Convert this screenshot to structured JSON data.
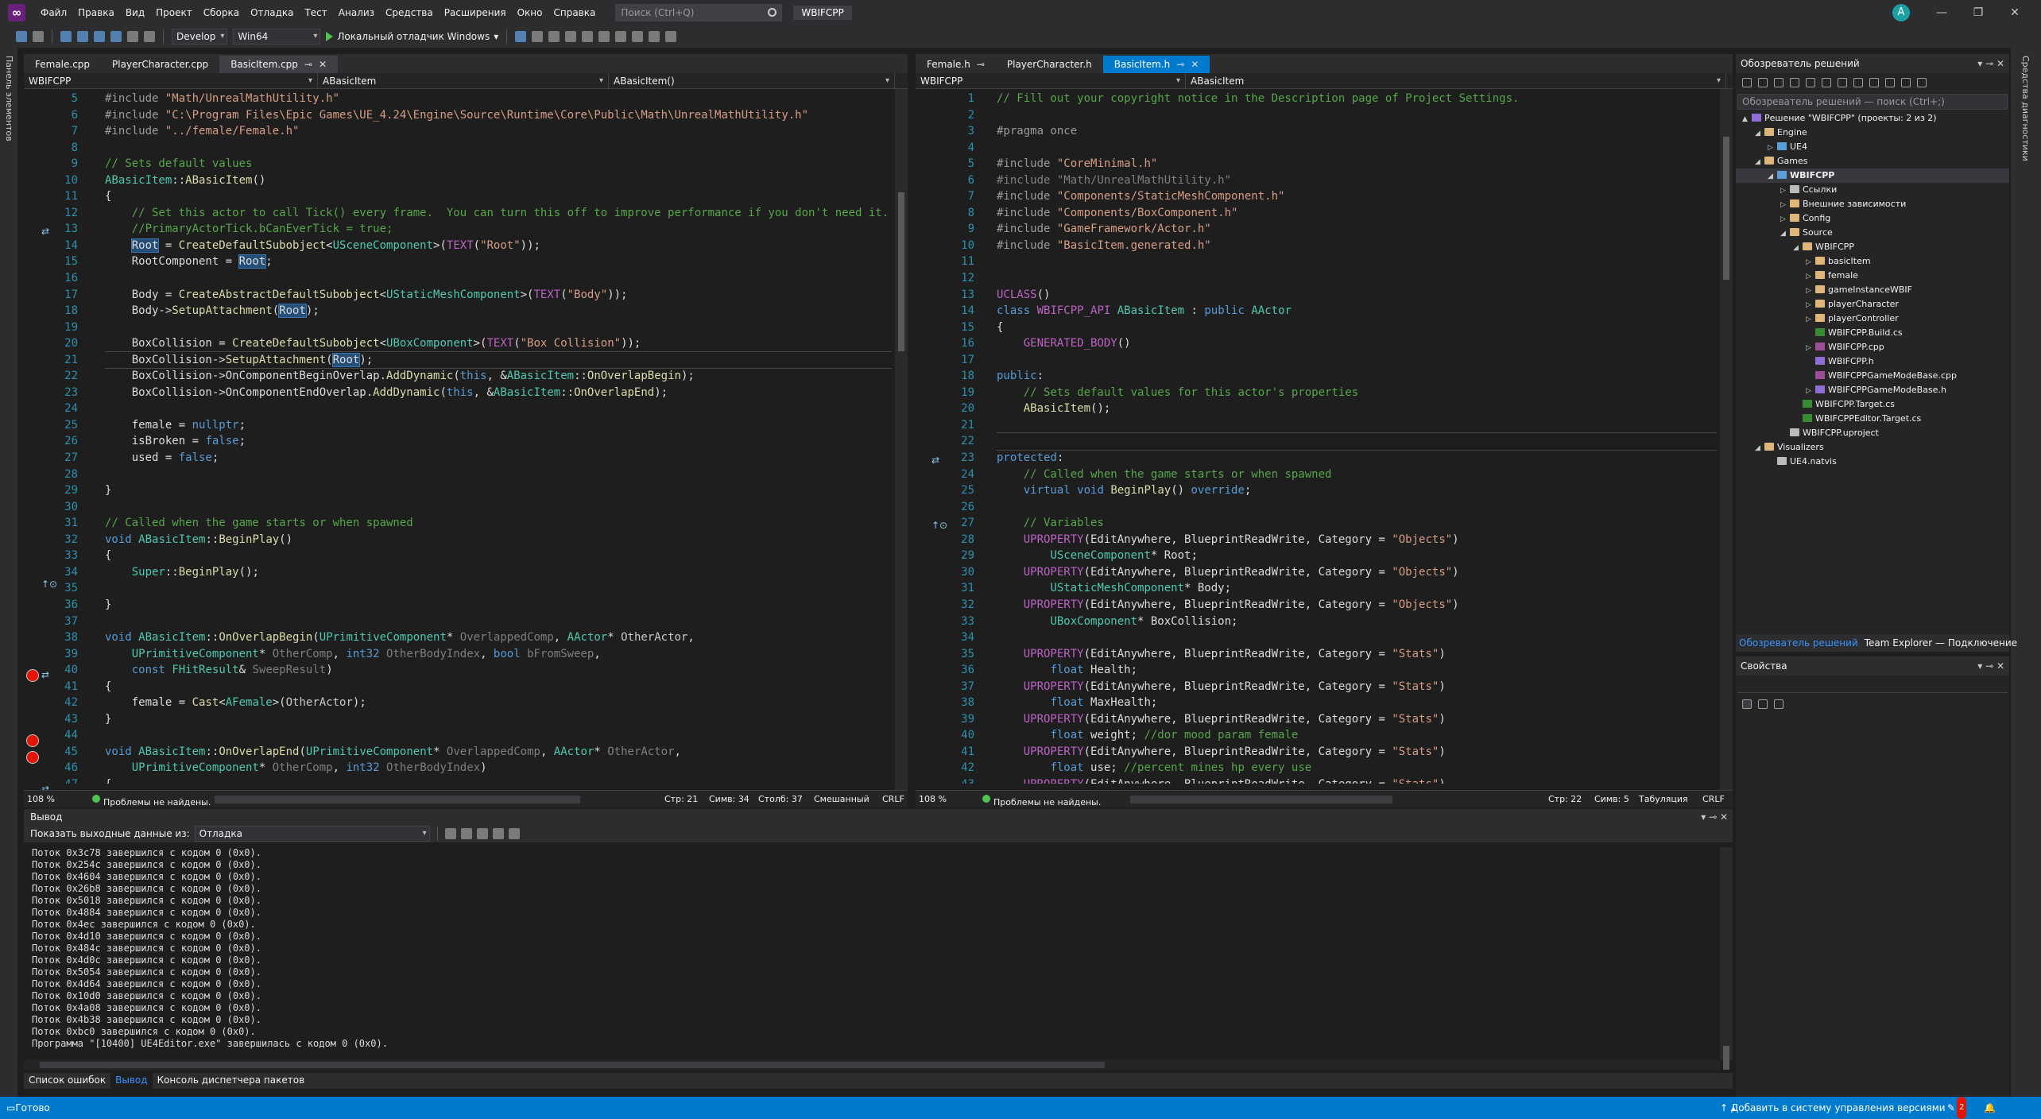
{
  "menu": {
    "items": [
      "Файл",
      "Правка",
      "Вид",
      "Проект",
      "Сборка",
      "Отладка",
      "Тест",
      "Анализ",
      "Средства",
      "Расширения",
      "Окно",
      "Справка"
    ],
    "search_placeholder": "Поиск (Ctrl+Q)",
    "solution": "WBIFCPP",
    "avatar_letter": "A"
  },
  "toolbar": {
    "config": "Develop",
    "platform": "Win64",
    "run_label": "Локальный отладчик Windows"
  },
  "left_strip": {
    "label": "Панель элементов"
  },
  "right_strip": {
    "label": "Средства диагностики"
  },
  "left_editor": {
    "tabs": [
      "Female.cpp",
      "PlayerCharacter.cpp",
      "BasicItem.cpp"
    ],
    "active_tab": 2,
    "nav": [
      "WBIFCPP",
      "ABasicItem",
      "ABasicItem()"
    ],
    "line_numbers": [
      "5",
      "6",
      "7",
      "8",
      "9",
      "10",
      "11",
      "12",
      "13",
      "14",
      "15",
      "16",
      "17",
      "18",
      "19",
      "20",
      "21",
      "22",
      "23",
      "24",
      "25",
      "26",
      "27",
      "28",
      "29",
      "30",
      "31",
      "32",
      "33",
      "34",
      "35",
      "36",
      "37",
      "38",
      "39",
      "40",
      "41",
      "42",
      "43",
      "44",
      "45",
      "46",
      "47"
    ],
    "status": {
      "zoom": "108 %",
      "problems": "Проблемы не найдены.",
      "line": "Стр: 21",
      "char": "Симв: 34",
      "col": "Столб: 37",
      "mode": "Смешанный",
      "eol": "CRLF"
    }
  },
  "right_editor": {
    "tabs": [
      "Female.h",
      "PlayerCharacter.h",
      "BasicItem.h"
    ],
    "active_tab": 2,
    "nav": [
      "WBIFCPP",
      "ABasicItem"
    ],
    "line_numbers": [
      "1",
      "2",
      "3",
      "4",
      "5",
      "6",
      "7",
      "8",
      "9",
      "10",
      "11",
      "12",
      "13",
      "14",
      "15",
      "16",
      "17",
      "18",
      "19",
      "20",
      "21",
      "22",
      "23",
      "24",
      "25",
      "26",
      "27",
      "28",
      "29",
      "30",
      "31",
      "32",
      "33",
      "34",
      "35",
      "36",
      "37",
      "38",
      "39",
      "40",
      "41",
      "42",
      "43"
    ],
    "status": {
      "zoom": "108 %",
      "problems": "Проблемы не найдены.",
      "line": "Стр: 22",
      "char": "Симв: 5",
      "indent": "Табуляция",
      "eol": "CRLF"
    }
  },
  "solution_explorer": {
    "title": "Обозреватель решений",
    "search_placeholder": "Обозреватель решений — поиск (Ctrl+;)",
    "tree": [
      {
        "label": "Решение \"WBIFCPP\" (проекты: 2 из 2)",
        "indent": 0,
        "type": "sol",
        "arrow": "▲"
      },
      {
        "label": "Engine",
        "indent": 1,
        "type": "folder",
        "arrow": "◢"
      },
      {
        "label": "UE4",
        "indent": 2,
        "type": "proj",
        "arrow": "▷"
      },
      {
        "label": "Games",
        "indent": 1,
        "type": "folder",
        "arrow": "◢"
      },
      {
        "label": "WBIFCPP",
        "indent": 2,
        "type": "proj",
        "arrow": "◢",
        "selected": true
      },
      {
        "label": "Ссылки",
        "indent": 3,
        "type": "file",
        "arrow": "▷"
      },
      {
        "label": "Внешние зависимости",
        "indent": 3,
        "type": "folder",
        "arrow": "▷"
      },
      {
        "label": "Config",
        "indent": 3,
        "type": "folder",
        "arrow": "▷"
      },
      {
        "label": "Source",
        "indent": 3,
        "type": "folder",
        "arrow": "◢"
      },
      {
        "label": "WBIFCPP",
        "indent": 4,
        "type": "folder",
        "arrow": "◢"
      },
      {
        "label": "basicItem",
        "indent": 5,
        "type": "folder",
        "arrow": "▷"
      },
      {
        "label": "female",
        "indent": 5,
        "type": "folder",
        "arrow": "▷"
      },
      {
        "label": "gameInstanceWBIF",
        "indent": 5,
        "type": "folder",
        "arrow": "▷"
      },
      {
        "label": "playerCharacter",
        "indent": 5,
        "type": "folder",
        "arrow": "▷"
      },
      {
        "label": "playerController",
        "indent": 5,
        "type": "folder",
        "arrow": "▷"
      },
      {
        "label": "WBIFCPP.Build.cs",
        "indent": 5,
        "type": "cs",
        "arrow": ""
      },
      {
        "label": "WBIFCPP.cpp",
        "indent": 5,
        "type": "cpp",
        "arrow": "▷"
      },
      {
        "label": "WBIFCPP.h",
        "indent": 5,
        "type": "h",
        "arrow": ""
      },
      {
        "label": "WBIFCPPGameModeBase.cpp",
        "indent": 5,
        "type": "cpp",
        "arrow": ""
      },
      {
        "label": "WBIFCPPGameModeBase.h",
        "indent": 5,
        "type": "h",
        "arrow": "▷"
      },
      {
        "label": "WBIFCPP.Target.cs",
        "indent": 4,
        "type": "cs",
        "arrow": ""
      },
      {
        "label": "WBIFCPPEditor.Target.cs",
        "indent": 4,
        "type": "cs",
        "arrow": ""
      },
      {
        "label": "WBIFCPP.uproject",
        "indent": 3,
        "type": "file",
        "arrow": ""
      },
      {
        "label": "Visualizers",
        "indent": 1,
        "type": "folder",
        "arrow": "◢"
      },
      {
        "label": "UE4.natvis",
        "indent": 2,
        "type": "file",
        "arrow": ""
      }
    ],
    "bottom_tabs": [
      "Обозреватель решений",
      "Team Explorer — Подключение"
    ]
  },
  "properties": {
    "title": "Свойства"
  },
  "output": {
    "title": "Вывод",
    "show_from_label": "Показать выходные данные из:",
    "source": "Отладка",
    "lines": [
      "Поток 0x3c78 завершился с кодом 0 (0x0).",
      "Поток 0x254c завершился с кодом 0 (0x0).",
      "Поток 0x4604 завершился с кодом 0 (0x0).",
      "Поток 0x26b8 завершился с кодом 0 (0x0).",
      "Поток 0x5018 завершился с кодом 0 (0x0).",
      "Поток 0x4884 завершился с кодом 0 (0x0).",
      "Поток 0x4ec завершился с кодом 0 (0x0).",
      "Поток 0x4d10 завершился с кодом 0 (0x0).",
      "Поток 0x484c завершился с кодом 0 (0x0).",
      "Поток 0x4d0c завершился с кодом 0 (0x0).",
      "Поток 0x5054 завершился с кодом 0 (0x0).",
      "Поток 0x4d64 завершился с кодом 0 (0x0).",
      "Поток 0x10d0 завершился с кодом 0 (0x0).",
      "Поток 0x4a08 завершился с кодом 0 (0x0).",
      "Поток 0x4b38 завершился с кодом 0 (0x0).",
      "Поток 0xbc0 завершился с кодом 0 (0x0).",
      "Программа \"[10400] UE4Editor.exe\" завершилась с кодом 0 (0x0)."
    ]
  },
  "bottom_tabs": [
    "Список ошибок",
    "Вывод",
    "Консоль диспетчера пакетов"
  ],
  "statusbar": {
    "ready": "Готово",
    "vcs": "Добавить в систему управления версиями",
    "errors": "2"
  },
  "colors": {
    "accent": "#007acc",
    "breakpoint": "#e51400",
    "bg": "#1e1e1e"
  }
}
